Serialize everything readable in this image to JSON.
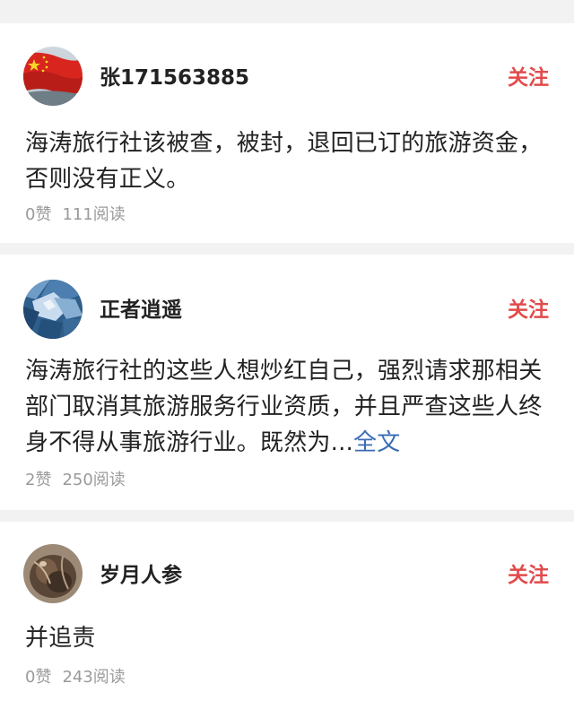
{
  "posts": [
    {
      "username": "张171563885",
      "follow_label": "关注",
      "avatar_icon": "china-flag-avatar",
      "content": "海涛旅行社该被查，被封，退回已订的旅游资金，否则没有正义。",
      "more_label": "",
      "likes": "0赞",
      "reads": "111阅读"
    },
    {
      "username": "正者逍遥",
      "follow_label": "关注",
      "avatar_icon": "blue-abstract-avatar",
      "content": "海涛旅行社的这些人想炒红自己，强烈请求那相关部门取消其旅游服务行业资质，并且严查这些人终身不得从事旅游行业。既然为...",
      "more_label": "全文",
      "likes": "2赞",
      "reads": "250阅读"
    },
    {
      "username": "岁月人参",
      "follow_label": "关注",
      "avatar_icon": "ginseng-avatar",
      "content": "并追责",
      "more_label": "",
      "likes": "0赞",
      "reads": "243阅读"
    }
  ],
  "colors": {
    "follow": "#e24b4b",
    "more_link": "#3a6cb4",
    "meta": "#9a9a9a",
    "separator": "#f2f2f2"
  }
}
